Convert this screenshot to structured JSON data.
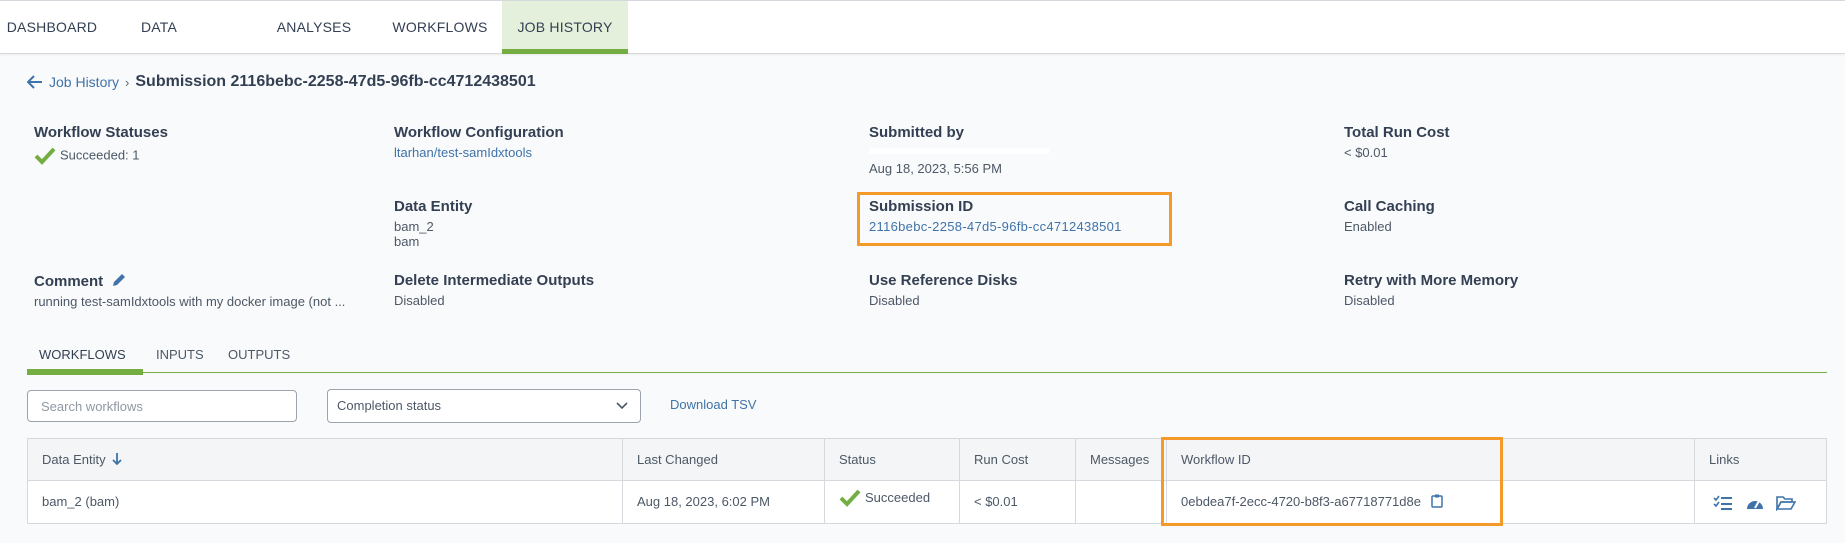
{
  "nav": {
    "tabs": [
      "DASHBOARD",
      "DATA",
      "ANALYSES",
      "WORKFLOWS",
      "JOB HISTORY"
    ],
    "active": "JOB HISTORY"
  },
  "breadcrumb": {
    "back_link": "Job History",
    "title": "Submission 2116bebc-2258-47d5-96fb-cc4712438501"
  },
  "summary": {
    "workflow_statuses": {
      "label": "Workflow Statuses",
      "value": "Succeeded: 1"
    },
    "workflow_configuration": {
      "label": "Workflow Configuration",
      "value": "ltarhan/test-samIdxtools"
    },
    "submitted_by": {
      "label": "Submitted by",
      "value": "Aug 18, 2023, 5:56 PM"
    },
    "total_run_cost": {
      "label": "Total Run Cost",
      "value": "< $0.01"
    },
    "data_entity": {
      "label": "Data Entity",
      "value_line1": "bam_2",
      "value_line2": "bam"
    },
    "submission_id": {
      "label": "Submission ID",
      "value": "2116bebc-2258-47d5-96fb-cc4712438501"
    },
    "call_caching": {
      "label": "Call Caching",
      "value": "Enabled"
    },
    "comment": {
      "label": "Comment",
      "value": "running test-samIdxtools with my docker image (not ..."
    },
    "delete_intermediate_outputs": {
      "label": "Delete Intermediate Outputs",
      "value": "Disabled"
    },
    "use_reference_disks": {
      "label": "Use Reference Disks",
      "value": "Disabled"
    },
    "retry_with_more_memory": {
      "label": "Retry with More Memory",
      "value": "Disabled"
    }
  },
  "subtabs": {
    "items": [
      "WORKFLOWS",
      "INPUTS",
      "OUTPUTS"
    ],
    "active": "WORKFLOWS"
  },
  "controls": {
    "search_placeholder": "Search workflows",
    "completion_select": "Completion status",
    "download_link": "Download TSV"
  },
  "table": {
    "columns": [
      "Data Entity",
      "Last Changed",
      "Status",
      "Run Cost",
      "Messages",
      "Workflow ID",
      "Links"
    ],
    "rows": [
      {
        "data_entity": "bam_2 (bam)",
        "last_changed": "Aug 18, 2023, 6:02 PM",
        "status": "Succeeded",
        "run_cost": "< $0.01",
        "messages": "",
        "workflow_id": "0ebdea7f-2ecc-4720-b8f3-a67718771d8e"
      }
    ]
  },
  "colors": {
    "accent_green": "#74ae43",
    "link_blue": "#3f73a9",
    "highlight_orange": "#f39a2b",
    "text": "#333f52"
  },
  "icons": [
    "back-arrow-icon",
    "checkmark-icon",
    "pencil-icon",
    "chevron-down-icon",
    "sort-down-icon",
    "copy-icon",
    "task-list-icon",
    "dashboard-icon",
    "folder-open-icon"
  ]
}
